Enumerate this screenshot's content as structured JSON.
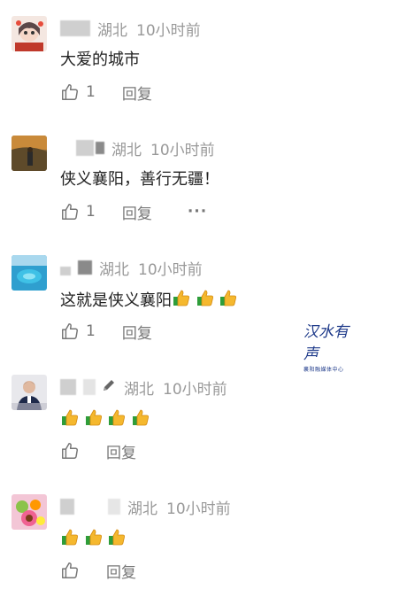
{
  "comments": [
    {
      "location": "湖北",
      "time": "10小时前",
      "text": "大爱的城市",
      "emoji": [],
      "likes": "1",
      "reply_label": "回复",
      "show_more": false,
      "more_label": ""
    },
    {
      "location": "湖北",
      "time": "10小时前",
      "text": "侠义襄阳，善行无疆！",
      "emoji": [],
      "likes": "1",
      "reply_label": "回复",
      "show_more": true,
      "more_label": "···"
    },
    {
      "location": "湖北",
      "time": "10小时前",
      "text": "这就是侠义襄阳",
      "emoji": [
        "thumbs-up",
        "thumbs-up",
        "thumbs-up"
      ],
      "likes": "1",
      "reply_label": "回复",
      "show_more": false,
      "more_label": ""
    },
    {
      "location": "湖北",
      "time": "10小时前",
      "text": "",
      "emoji": [
        "thumbs-up",
        "thumbs-up",
        "thumbs-up",
        "thumbs-up"
      ],
      "likes": "",
      "reply_label": "回复",
      "show_more": false,
      "more_label": ""
    },
    {
      "location": "湖北",
      "time": "10小时前",
      "text": "",
      "emoji": [
        "thumbs-up",
        "thumbs-up",
        "thumbs-up"
      ],
      "likes": "",
      "reply_label": "回复",
      "show_more": false,
      "more_label": ""
    }
  ],
  "watermark": {
    "brand": "汉水有声",
    "subtitle": "襄阳融媒体中心"
  }
}
